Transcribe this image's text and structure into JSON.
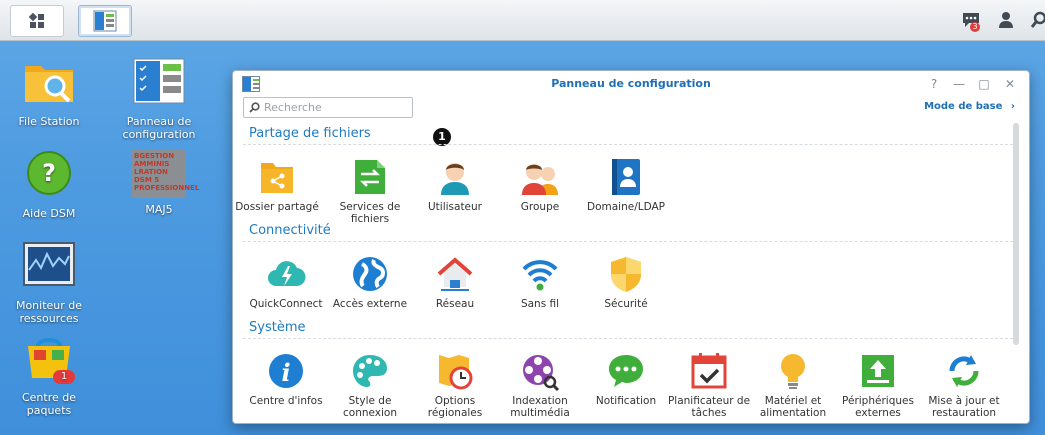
{
  "taskbar": {
    "main_menu_icon": "grid-icon",
    "control_panel_icon": "control-panel-icon",
    "notifications_badge": "3",
    "icons": [
      "chat-icon",
      "user-icon",
      "search-icon"
    ]
  },
  "desktop": {
    "icons": [
      {
        "label": "File Station",
        "icon": "folder-search-icon"
      },
      {
        "label": "Panneau de configuration",
        "icon": "control-panel-icon"
      },
      {
        "label": "Aide DSM",
        "icon": "help-icon"
      },
      {
        "label": "MAJ5",
        "icon": "image-icon"
      },
      {
        "label": "Moniteur de ressources",
        "icon": "monitor-icon"
      },
      {
        "label": "Centre de paquets",
        "icon": "package-icon",
        "badge": "1"
      }
    ],
    "maj5_image_text": "BGESTION AMMINIS LRATION DSM 5 PROFESSIONNEL"
  },
  "window": {
    "title": "Panneau de configuration",
    "controls": [
      "?",
      "—",
      "□",
      "✕"
    ],
    "search_placeholder": "Recherche",
    "mode_label": "Mode de base",
    "marker": "1",
    "sections": [
      {
        "title": "Partage de fichiers",
        "items": [
          {
            "label": "Dossier partagé",
            "icon": "shared-folder-icon"
          },
          {
            "label": "Services de fichiers",
            "icon": "file-services-icon"
          },
          {
            "label": "Utilisateur",
            "icon": "user-icon"
          },
          {
            "label": "Groupe",
            "icon": "group-icon"
          },
          {
            "label": "Domaine/LDAP",
            "icon": "domain-ldap-icon"
          }
        ]
      },
      {
        "title": "Connectivité",
        "items": [
          {
            "label": "QuickConnect",
            "icon": "quickconnect-icon"
          },
          {
            "label": "Accès externe",
            "icon": "globe-icon"
          },
          {
            "label": "Réseau",
            "icon": "home-network-icon"
          },
          {
            "label": "Sans fil",
            "icon": "wifi-icon"
          },
          {
            "label": "Sécurité",
            "icon": "shield-icon"
          }
        ]
      },
      {
        "title": "Système",
        "items": [
          {
            "label": "Centre d'infos",
            "icon": "info-icon"
          },
          {
            "label": "Style de connexion",
            "icon": "palette-icon"
          },
          {
            "label": "Options régionales",
            "icon": "clock-map-icon"
          },
          {
            "label": "Indexation multimédia",
            "icon": "film-reel-icon"
          },
          {
            "label": "Notification",
            "icon": "speech-bubble-icon"
          },
          {
            "label": "Planificateur de tâches",
            "icon": "calendar-check-icon"
          },
          {
            "label": "Matériel et alimentation",
            "icon": "light-bulb-icon"
          },
          {
            "label": "Périphériques externes",
            "icon": "external-device-icon"
          },
          {
            "label": "Mise à jour et restauration",
            "icon": "refresh-icon"
          }
        ]
      }
    ]
  }
}
